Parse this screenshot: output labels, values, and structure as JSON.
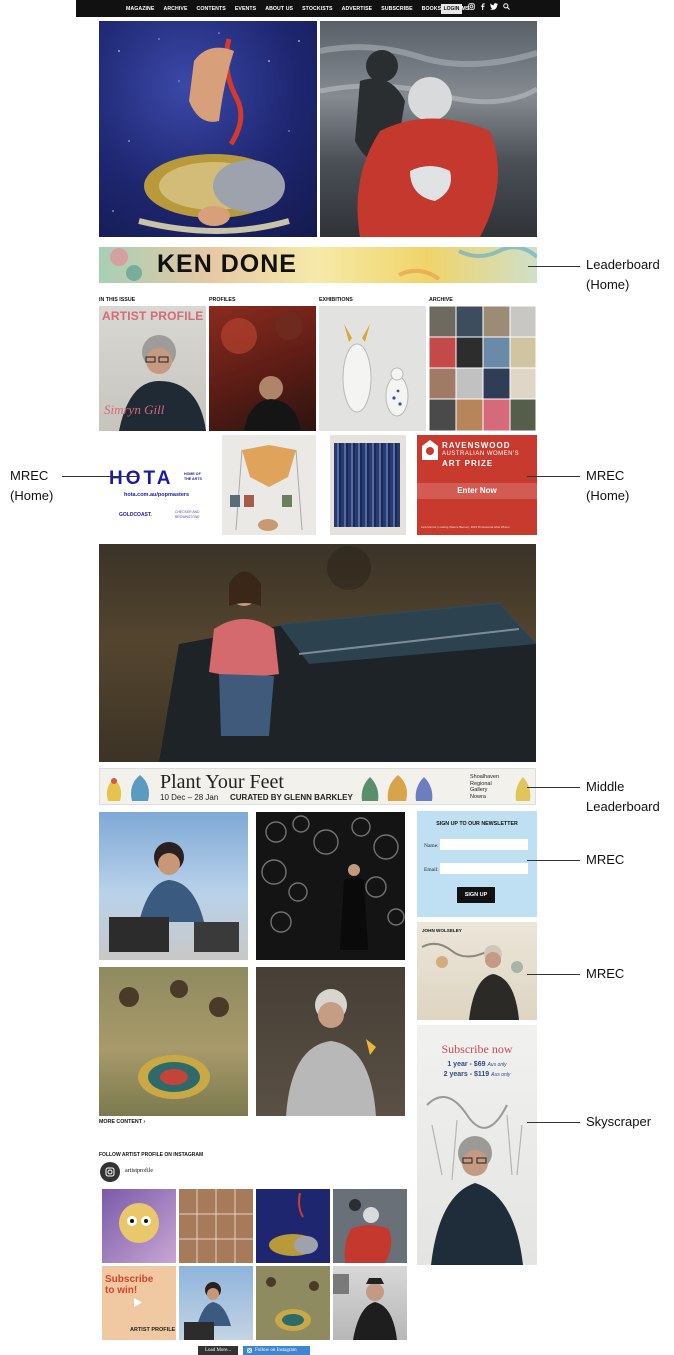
{
  "nav": {
    "items": [
      "MAGAZINE",
      "ARCHIVE",
      "CONTENTS",
      "EVENTS",
      "ABOUT US",
      "STOCKISTS",
      "ADVERTISE",
      "SUBSCRIBE",
      "BOOKS",
      "POEMS"
    ],
    "login_label": "LOGIN",
    "icons": [
      "instagram-icon",
      "facebook-icon",
      "twitter-icon",
      "search-icon"
    ]
  },
  "banner_top": {
    "text": "KEN DONE"
  },
  "sections": {
    "in_this_issue": "IN THIS ISSUE",
    "profiles": "PROFILES",
    "exhibitions": "EXHIBITIONS",
    "archive": "ARCHIVE"
  },
  "cover": {
    "masthead": "ARTIST PROFILE",
    "name": "Simryn Gill"
  },
  "hota_ad": {
    "logo": "HOTA",
    "tagline": "HOME OF THE ARTS",
    "url": "hota.com.au/popmasters",
    "sponsor_left": "GOLDCOAST.",
    "sponsor_right": "CHECKER AND BROWNSTONE"
  },
  "ravenswood_ad": {
    "title_line1": "RAVENSWOOD",
    "title_line2": "AUSTRALIAN WOMEN'S",
    "title_line3": "ART PRIZE",
    "cta": "Enter Now",
    "footer": "Lara Merrett | Looking (Nature Banner), 2023 Professional Artist Winner"
  },
  "middle_banner": {
    "title": "Plant Your Feet",
    "dates": "10 Dec – 28 Jan",
    "curator": "CURATED BY GLENN BARKLEY",
    "venue_line1": "Shoalhaven",
    "venue_line2": "Regional",
    "venue_line3": "Gallery",
    "venue_line4": "Nowra"
  },
  "newsletter": {
    "heading": "SIGN UP TO OUR NEWSLETTER",
    "name_label": "Name:",
    "email_label": "Email:",
    "button": "SIGN UP"
  },
  "wolseley_ad": {
    "label": "JOHN WOLSELEY"
  },
  "skyscraper": {
    "title": "Subscribe now",
    "offer1_price": "1 year - $69",
    "offer1_note": "Aus only",
    "offer2_price": "2 years - $119",
    "offer2_note": "Aus only"
  },
  "more_content": "MORE CONTENT ›",
  "instagram": {
    "heading": "FOLLOW ARTIST PROFILE ON INSTAGRAM",
    "handle": "artistprofile",
    "subscribe_tile_line1": "Subscribe",
    "subscribe_tile_line2": "to win!",
    "subscribe_tile_footer": "ARTIST PROFILE",
    "load_more": "Load More...",
    "follow": "Follow on Instagram"
  },
  "annotations": {
    "leaderboard": [
      "Leaderboard",
      "(Home)"
    ],
    "mrec_left": [
      "MREC",
      "(Home)"
    ],
    "mrec_right": [
      "MREC",
      "(Home)"
    ],
    "middle_leaderboard": [
      "Middle",
      "Leaderboard"
    ],
    "mrec_newsletter": "MREC",
    "mrec_wolseley": "MREC",
    "skyscraper": "Skyscraper"
  },
  "colors": {
    "nav_bg": "#111111",
    "hota_blue": "#1a1aa6",
    "ravenswood_red": "#c8392e",
    "newsletter_bg": "#bfe0f2",
    "skyscraper_pink": "#c94a5a",
    "instagram_blue": "#3f86d2"
  }
}
